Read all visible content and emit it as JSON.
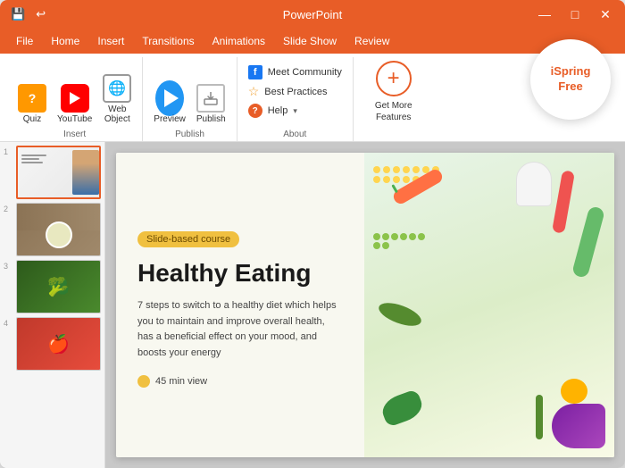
{
  "window": {
    "title": "PowerPoint",
    "controls": {
      "minimize": "—",
      "maximize": "□",
      "close": "✕"
    },
    "titlebar_left": [
      "💾",
      "↩"
    ]
  },
  "menu": {
    "items": [
      "File",
      "Home",
      "Insert",
      "Transitions",
      "Animations",
      "Slide Show",
      "Review"
    ]
  },
  "ribbon": {
    "groups": [
      {
        "name": "Insert",
        "items": [
          {
            "id": "quiz",
            "label": "Quiz"
          },
          {
            "id": "youtube",
            "label": "YouTube"
          },
          {
            "id": "webobject",
            "label": "Web\nObject"
          }
        ]
      },
      {
        "name": "Publish",
        "items": [
          {
            "id": "preview",
            "label": "Preview"
          },
          {
            "id": "publish",
            "label": "Publish"
          }
        ]
      },
      {
        "name": "About",
        "items": [
          {
            "id": "meet-community",
            "label": "Meet Community"
          },
          {
            "id": "best-practices",
            "label": "Best Practices"
          },
          {
            "id": "help",
            "label": "Help"
          }
        ]
      }
    ],
    "get_more": {
      "label_line1": "Get More",
      "label_line2": "Features"
    }
  },
  "ispring": {
    "badge_line1": "iSpring",
    "badge_line2": "Free"
  },
  "slides": [
    {
      "number": "1",
      "selected": true
    },
    {
      "number": "2",
      "selected": false
    },
    {
      "number": "3",
      "selected": false
    },
    {
      "number": "4",
      "selected": false
    }
  ],
  "main_slide": {
    "badge": "Slide-based course",
    "title": "Healthy Eating",
    "description": "7 steps to switch to a healthy diet which helps you to maintain and improve overall health, has a beneficial effect on your mood, and boosts your energy",
    "duration": "45 min view"
  }
}
